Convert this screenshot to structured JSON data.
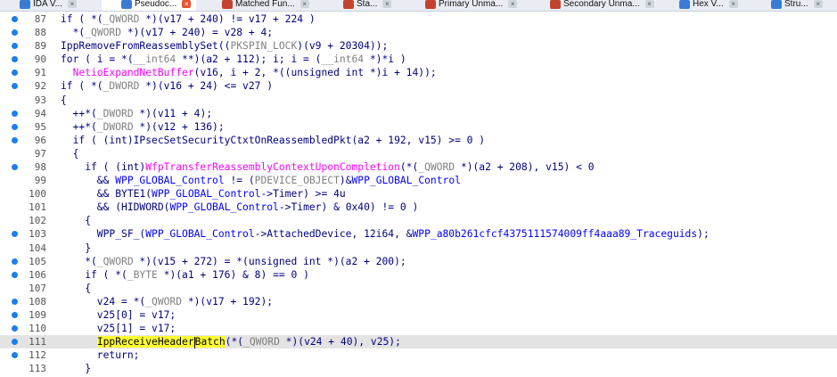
{
  "tabs": [
    {
      "label": "IDA V...",
      "icon": "ida-view-icon",
      "color": "#3a7bd5",
      "active": false
    },
    {
      "label": "Pseudoc...",
      "icon": "pseudocode-icon",
      "color": "#3a7bd5",
      "active": true
    },
    {
      "label": "Matched Fun...",
      "icon": "matched-functions-icon",
      "color": "#c2442e",
      "active": false
    },
    {
      "label": "Sta...",
      "icon": "statistics-icon",
      "color": "#c2442e",
      "active": false
    },
    {
      "label": "Primary Unma...",
      "icon": "primary-unmatched-icon",
      "color": "#c2442e",
      "active": false
    },
    {
      "label": "Secondary Unma...",
      "icon": "secondary-unmatched-icon",
      "color": "#c2442e",
      "active": false
    },
    {
      "label": "Hex V...",
      "icon": "hex-view-icon",
      "color": "#3a7bd5",
      "active": false
    },
    {
      "label": "Stru...",
      "icon": "structures-icon",
      "color": "#3a7bd5",
      "active": false
    }
  ],
  "code": {
    "current_line": 111,
    "lines": [
      {
        "n": 87,
        "bp": true,
        "segs": [
          [
            "if ( *(",
            "p"
          ],
          [
            "_QWORD",
            "c"
          ],
          [
            " *)(v17 + 240) != v17 + 224 )",
            "p"
          ]
        ]
      },
      {
        "n": 88,
        "bp": true,
        "segs": [
          [
            "  *(",
            "p"
          ],
          [
            "_QWORD",
            "c"
          ],
          [
            " *)(v17 + 240) = v28 + 4;",
            "p"
          ]
        ]
      },
      {
        "n": 89,
        "bp": true,
        "segs": [
          [
            "IppRemoveFromReassemblySet((",
            "p"
          ],
          [
            "PKSPIN_LOCK",
            "c"
          ],
          [
            ")(v9 + 20304));",
            "p"
          ]
        ]
      },
      {
        "n": 90,
        "bp": true,
        "segs": [
          [
            "for ( i = *(",
            "p"
          ],
          [
            "__int64",
            "c"
          ],
          [
            " **)(a2 + 112); i; i = (",
            "p"
          ],
          [
            "__int64",
            "c"
          ],
          [
            " *)*i )",
            "p"
          ]
        ]
      },
      {
        "n": 91,
        "bp": true,
        "segs": [
          [
            "  ",
            "p"
          ],
          [
            "NetioExpandNetBuffer",
            "f"
          ],
          [
            "(v16, i + 2, *((unsigned int *)i + 14));",
            "p"
          ]
        ]
      },
      {
        "n": 92,
        "bp": true,
        "segs": [
          [
            "if ( *(",
            "p"
          ],
          [
            "_DWORD",
            "c"
          ],
          [
            " *)(v16 + 24) <= v27 )",
            "p"
          ]
        ]
      },
      {
        "n": 93,
        "bp": false,
        "segs": [
          [
            "{",
            "p"
          ]
        ]
      },
      {
        "n": 94,
        "bp": true,
        "segs": [
          [
            "  ++*(",
            "p"
          ],
          [
            "_DWORD",
            "c"
          ],
          [
            " *)(v11 + 4);",
            "p"
          ]
        ]
      },
      {
        "n": 95,
        "bp": true,
        "segs": [
          [
            "  ++*(",
            "p"
          ],
          [
            "_DWORD",
            "c"
          ],
          [
            " *)(v12 + 136);",
            "p"
          ]
        ]
      },
      {
        "n": 96,
        "bp": true,
        "segs": [
          [
            "  if ( (int)IPsecSetSecurityCtxtOnReassembledPkt(a2 + 192, v15) >= 0 )",
            "p"
          ]
        ]
      },
      {
        "n": 97,
        "bp": false,
        "segs": [
          [
            "  {",
            "p"
          ]
        ]
      },
      {
        "n": 98,
        "bp": true,
        "segs": [
          [
            "    if ( (int)",
            "p"
          ],
          [
            "WfpTransferReassemblyContextUponCompletion",
            "f"
          ],
          [
            "(*(",
            "p"
          ],
          [
            "_QWORD",
            "c"
          ],
          [
            " *)(a2 + 208), v15) < 0",
            "p"
          ]
        ]
      },
      {
        "n": 99,
        "bp": false,
        "segs": [
          [
            "      && ",
            "p"
          ],
          [
            "WPP_GLOBAL_Control",
            "u"
          ],
          [
            " != (",
            "p"
          ],
          [
            "PDEVICE_OBJECT",
            "c"
          ],
          [
            ")&",
            "p"
          ],
          [
            "WPP_GLOBAL_Control",
            "u"
          ]
        ]
      },
      {
        "n": 100,
        "bp": false,
        "segs": [
          [
            "      && BYTE1(",
            "p"
          ],
          [
            "WPP_GLOBAL_Control",
            "u"
          ],
          [
            "->Timer) >= 4u",
            "p"
          ]
        ]
      },
      {
        "n": 101,
        "bp": false,
        "segs": [
          [
            "      && (HIDWORD(",
            "p"
          ],
          [
            "WPP_GLOBAL_Control",
            "u"
          ],
          [
            "->Timer) & 0x40) != 0 )",
            "p"
          ]
        ]
      },
      {
        "n": 102,
        "bp": false,
        "segs": [
          [
            "    {",
            "p"
          ]
        ]
      },
      {
        "n": 103,
        "bp": true,
        "segs": [
          [
            "      WPP_SF_(",
            "p"
          ],
          [
            "WPP_GLOBAL_Control",
            "u"
          ],
          [
            "->AttachedDevice, 12i64, &",
            "p"
          ],
          [
            "WPP_a80b261cfcf4375111574009ff4aaa89_Traceguids",
            "u"
          ],
          [
            ");",
            "p"
          ]
        ]
      },
      {
        "n": 104,
        "bp": false,
        "segs": [
          [
            "    }",
            "p"
          ]
        ]
      },
      {
        "n": 105,
        "bp": true,
        "segs": [
          [
            "    *(",
            "p"
          ],
          [
            "_QWORD",
            "c"
          ],
          [
            " *)(v15 + 272) = *(unsigned int *)(a2 + 200);",
            "p"
          ]
        ]
      },
      {
        "n": 106,
        "bp": true,
        "segs": [
          [
            "    if ( *(",
            "p"
          ],
          [
            "_BYTE",
            "c"
          ],
          [
            " *)(a1 + 176) & 8) == 0 )",
            "p"
          ]
        ]
      },
      {
        "n": 107,
        "bp": false,
        "segs": [
          [
            "    {",
            "p"
          ]
        ]
      },
      {
        "n": 108,
        "bp": true,
        "segs": [
          [
            "      v24 = *(",
            "p"
          ],
          [
            "_QWORD",
            "c"
          ],
          [
            " *)(v17 + 192);",
            "p"
          ]
        ]
      },
      {
        "n": 109,
        "bp": true,
        "segs": [
          [
            "      v25[0] = v17;",
            "p"
          ]
        ]
      },
      {
        "n": 110,
        "bp": true,
        "segs": [
          [
            "      v25[1] = v17;",
            "p"
          ]
        ]
      },
      {
        "n": 111,
        "bp": true,
        "segs": [
          [
            "      ",
            "p"
          ],
          [
            "IppReceiveHeader",
            "h"
          ],
          [
            "|",
            "k"
          ],
          [
            "Batch",
            "h"
          ],
          [
            "(*(",
            "p"
          ],
          [
            "_QWORD",
            "c"
          ],
          [
            " *)(v24 + 40), v25);",
            "p"
          ]
        ]
      },
      {
        "n": 112,
        "bp": true,
        "segs": [
          [
            "      return;",
            "p"
          ]
        ]
      },
      {
        "n": 113,
        "bp": false,
        "segs": [
          [
            "    }",
            "p"
          ]
        ]
      }
    ]
  },
  "colors": {
    "text": "#00007f",
    "identifier": "#0000ff",
    "type_comment": "#808080",
    "import_function": "#ff00ff",
    "highlight": "#ffff30",
    "breakpoint_dot": "#1c7ee8",
    "current_line_bg": "#e3e3e3"
  }
}
